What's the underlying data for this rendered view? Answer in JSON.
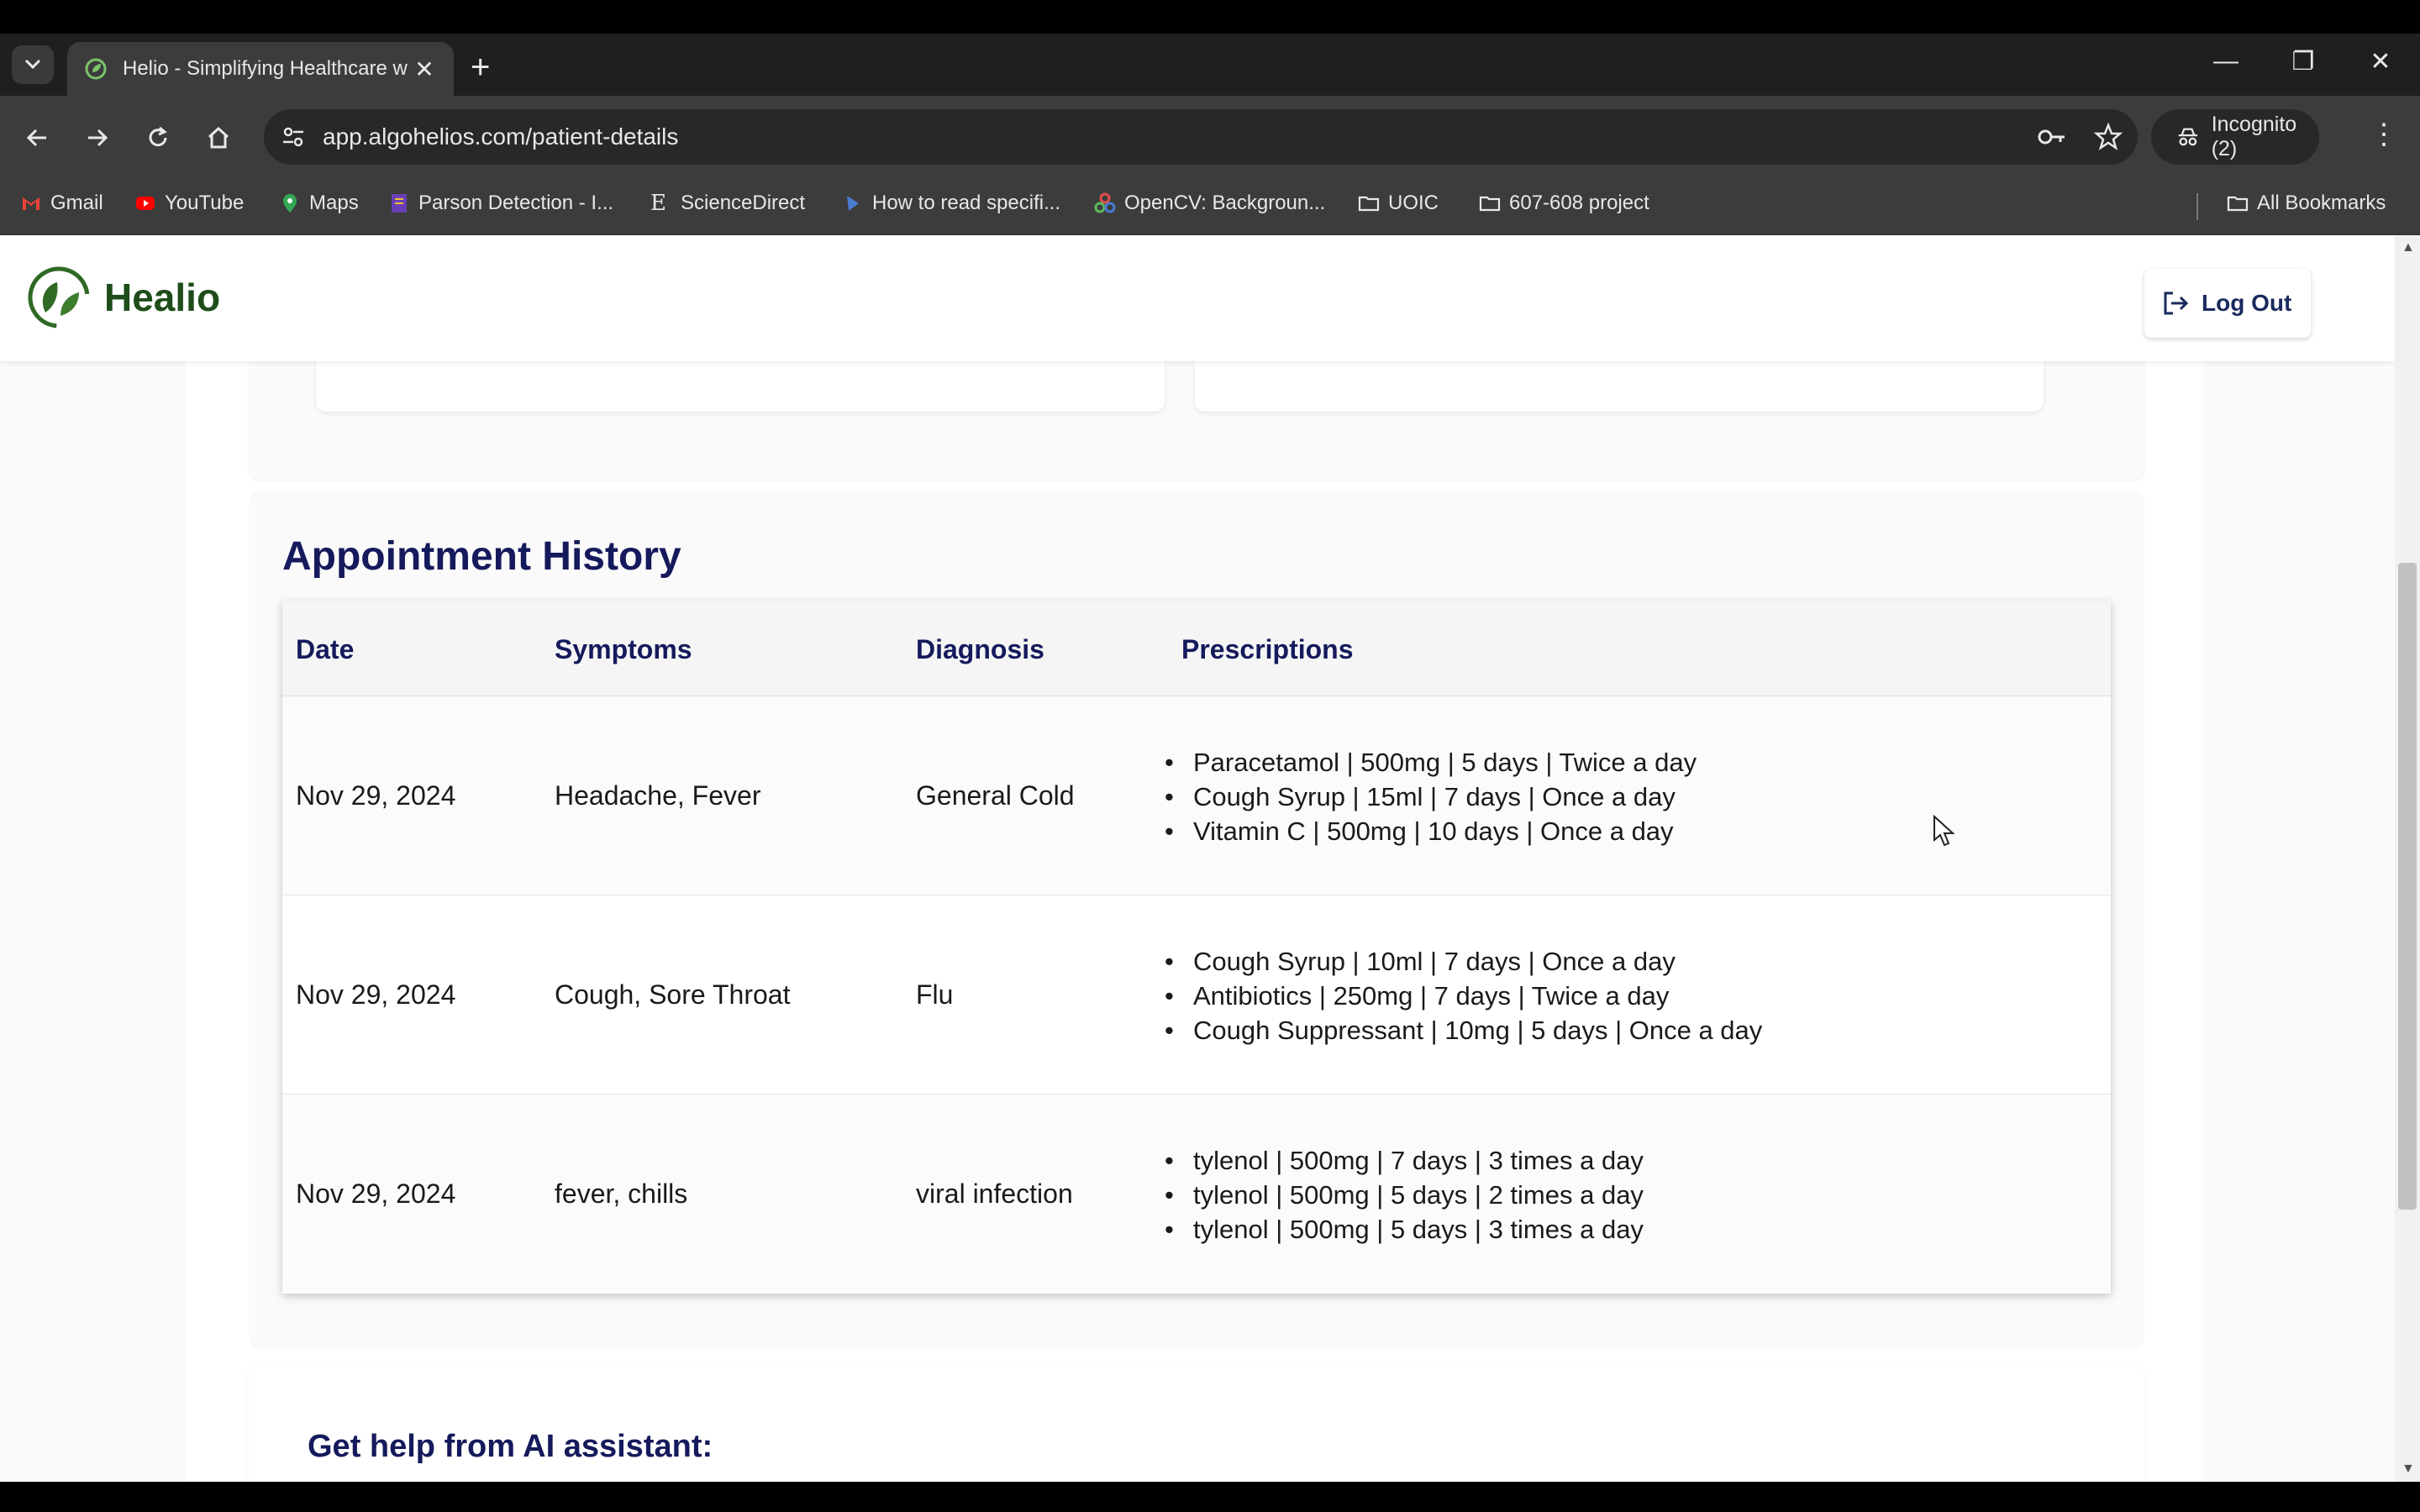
{
  "browser": {
    "tab_title": "Helio - Simplifying Healthcare w",
    "url": "app.algohelios.com/patient-details",
    "incognito_label": "Incognito (2)",
    "bookmarks": [
      {
        "label": "Gmail",
        "icon": "gmail-icon",
        "color": "#ea4335"
      },
      {
        "label": "YouTube",
        "icon": "youtube-icon",
        "color": "#ff0000"
      },
      {
        "label": "Maps",
        "icon": "maps-icon",
        "color": "#34a853"
      },
      {
        "label": "Parson Detection - I...",
        "icon": "bookmark-site-icon",
        "color": "#6a3fb5"
      },
      {
        "label": "ScienceDirect",
        "icon": "sciencedirect-icon",
        "color": "#e8e8e8"
      },
      {
        "label": "How to read specifi...",
        "icon": "bookmark-site-icon",
        "color": "#4a7bd0"
      },
      {
        "label": "OpenCV: Backgroun...",
        "icon": "opencv-icon",
        "color": "#5cb85c"
      },
      {
        "label": "UOIC",
        "icon": "folder-icon",
        "color": "#e8e8e8"
      },
      {
        "label": "607-608 project",
        "icon": "folder-icon",
        "color": "#e8e8e8"
      }
    ],
    "all_bookmarks_label": "All Bookmarks"
  },
  "header": {
    "brand": "Healio",
    "logout_label": "Log Out"
  },
  "appointments": {
    "title": "Appointment History",
    "columns": [
      "Date",
      "Symptoms",
      "Diagnosis",
      "Prescriptions"
    ],
    "rows": [
      {
        "date": "Nov 29, 2024",
        "symptoms": "Headache, Fever",
        "diagnosis": "General Cold",
        "prescriptions": [
          "Paracetamol | 500mg | 5 days | Twice a day",
          "Cough Syrup | 15ml | 7 days | Once a day",
          "Vitamin C | 500mg | 10 days | Once a day"
        ]
      },
      {
        "date": "Nov 29, 2024",
        "symptoms": "Cough, Sore Throat",
        "diagnosis": "Flu",
        "prescriptions": [
          "Cough Syrup | 10ml | 7 days | Once a day",
          "Antibiotics | 250mg | 7 days | Twice a day",
          "Cough Suppressant | 10mg | 5 days | Once a day"
        ]
      },
      {
        "date": "Nov 29, 2024",
        "symptoms": "fever, chills",
        "diagnosis": "viral infection",
        "prescriptions": [
          "tylenol | 500mg | 7 days | 3 times a day",
          "tylenol | 500mg | 5 days | 2 times a day",
          "tylenol | 500mg | 5 days | 3 times a day"
        ]
      }
    ]
  },
  "ai_assistant": {
    "title": "Get help from AI assistant:"
  },
  "colors": {
    "heading": "#151a5c",
    "brand_green": "#1e4d1a",
    "chrome_dark": "#3c3c3c"
  }
}
